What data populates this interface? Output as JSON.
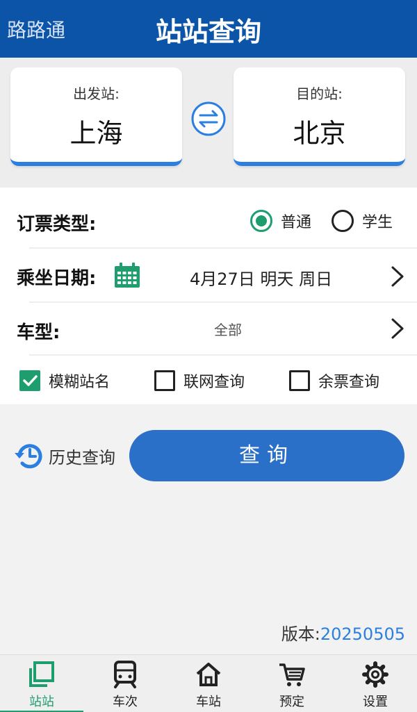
{
  "header": {
    "app_name": "路路通",
    "title": "站站查询"
  },
  "stations": {
    "from_label": "出发站:",
    "from_value": "上海",
    "to_label": "目的站:",
    "to_value": "北京",
    "swap_icon": "swap-icon"
  },
  "ticket_type": {
    "label": "订票类型:",
    "options": [
      {
        "label": "普通",
        "selected": true
      },
      {
        "label": "学生",
        "selected": false
      }
    ]
  },
  "date": {
    "label": "乘坐日期:",
    "icon": "calendar-icon",
    "value": "4月27日 明天 周日"
  },
  "train_type": {
    "label": "车型:",
    "value": "全部"
  },
  "checkboxes": [
    {
      "label": "模糊站名",
      "checked": true
    },
    {
      "label": "联网查询",
      "checked": false
    },
    {
      "label": "余票查询",
      "checked": false
    }
  ],
  "actions": {
    "history_label": "历史查询",
    "query_label": "查询"
  },
  "version": {
    "label": "版本:",
    "value": "20250505"
  },
  "tabs": [
    {
      "label": "站站",
      "icon": "stations-icon",
      "active": true
    },
    {
      "label": "车次",
      "icon": "train-icon",
      "active": false
    },
    {
      "label": "车站",
      "icon": "home-icon",
      "active": false
    },
    {
      "label": "预定",
      "icon": "cart-icon",
      "active": false
    },
    {
      "label": "设置",
      "icon": "gear-icon",
      "active": false
    }
  ],
  "colors": {
    "header_bg": "#0b54a8",
    "accent_blue": "#2a7fe0",
    "button_blue": "#2a6fc8",
    "accent_green": "#1e9e6e"
  }
}
